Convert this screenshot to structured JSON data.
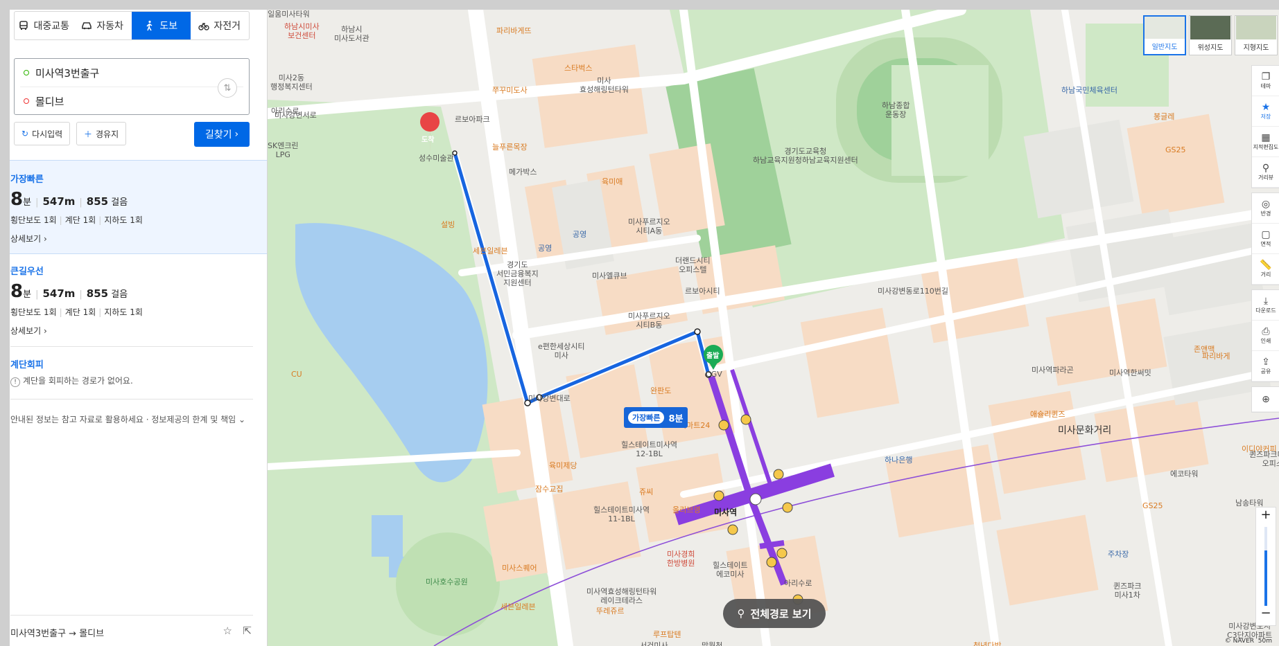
{
  "tabs": [
    {
      "label": "대중교통",
      "icon": "bus-icon"
    },
    {
      "label": "자동차",
      "icon": "car-icon"
    },
    {
      "label": "도보",
      "icon": "walk-icon"
    },
    {
      "label": "자전거",
      "icon": "bicycle-icon"
    }
  ],
  "active_tab": "도보",
  "start": "미사역3번출구",
  "destination": "몰디브",
  "buttons": {
    "reset": "다시입력",
    "waypoint": "경유지",
    "find": "길찾기"
  },
  "routes": [
    {
      "title": "가장빠른",
      "time": "8",
      "time_unit": "분",
      "distance": "547m",
      "steps": "855",
      "steps_unit": "걸음",
      "crosswalk": "횡단보도 1회",
      "stairs": "계단 1회",
      "underpass": "지하도 1회",
      "more": "상세보기"
    },
    {
      "title": "큰길우선",
      "time": "8",
      "time_unit": "분",
      "distance": "547m",
      "steps": "855",
      "steps_unit": "걸음",
      "crosswalk": "횡단보도 1회",
      "stairs": "계단 1회",
      "underpass": "지하도 1회",
      "more": "상세보기"
    }
  ],
  "stairs_avoid": {
    "title": "계단회피",
    "message": "계단을 회피하는 경로가 없어요."
  },
  "disclaimer": "안내된 정보는 참고 자료로 활용하세요 · 정보제공의 한계 및 책임",
  "footer": {
    "from": "미사역3번출구",
    "arrow": "→",
    "to": "몰디브"
  },
  "map": {
    "map_types": [
      "일반지도",
      "위성지도",
      "지형지도"
    ],
    "selected_map_type": "일반지도",
    "tools": [
      "테마",
      "저장",
      "지적편집도",
      "거리뷰",
      "반경",
      "면적",
      "거리",
      "다운로드",
      "인쇄",
      "공유"
    ],
    "route_badge": {
      "label": "가장빠른",
      "time": "8분"
    },
    "start_marker": "출발",
    "end_marker": "도착",
    "full_route_button": "전체경로 보기",
    "scale": "50m",
    "copyright": "© NAVER",
    "labels": [
      {
        "text": "하남시미사\n보건센터",
        "cls": "pink"
      },
      {
        "text": "하남시\n미사도서관",
        "cls": ""
      },
      {
        "text": "파리바게뜨",
        "cls": "orange"
      },
      {
        "text": "스타벅스",
        "cls": "orange"
      },
      {
        "text": "미사\n효성해링턴타워",
        "cls": ""
      },
      {
        "text": "쭈꾸미도사",
        "cls": "orange"
      },
      {
        "text": "르보아파크",
        "cls": ""
      },
      {
        "text": "늘푸른목장",
        "cls": "orange"
      },
      {
        "text": "메가박스",
        "cls": ""
      },
      {
        "text": "미사2동\n행정복지센터",
        "cls": ""
      },
      {
        "text": "아리수로",
        "cls": ""
      },
      {
        "text": "SK엔크린\nLPG",
        "cls": ""
      },
      {
        "text": "성수미술관",
        "cls": ""
      },
      {
        "text": "설빙",
        "cls": "orange"
      },
      {
        "text": "세븐일레븐",
        "cls": "orange"
      },
      {
        "text": "경기도\n서민금융복지\n지원센터",
        "cls": ""
      },
      {
        "text": "공영",
        "cls": "blue"
      },
      {
        "text": "공영",
        "cls": "blue"
      },
      {
        "text": "육미애",
        "cls": "orange"
      },
      {
        "text": "미사푸르지오\n시티A동",
        "cls": ""
      },
      {
        "text": "더랜드시티\n오피스텔",
        "cls": ""
      },
      {
        "text": "미사엘큐브",
        "cls": ""
      },
      {
        "text": "르보아시티",
        "cls": ""
      },
      {
        "text": "미사푸르지오\n시티B동",
        "cls": ""
      },
      {
        "text": "e편한세상시티\n미사",
        "cls": ""
      },
      {
        "text": "CGV",
        "cls": ""
      },
      {
        "text": "완판도",
        "cls": "orange"
      },
      {
        "text": "이마트24",
        "cls": "orange"
      },
      {
        "text": "힐스테이트미사역\n12-1BL",
        "cls": ""
      },
      {
        "text": "육미제당",
        "cls": "orange"
      },
      {
        "text": "잠수교집",
        "cls": "orange"
      },
      {
        "text": "쥬씨",
        "cls": "orange"
      },
      {
        "text": "올리브영",
        "cls": "orange"
      },
      {
        "text": "미사역",
        "cls": "bold"
      },
      {
        "text": "힐스테이트미사역\n11-1BL",
        "cls": ""
      },
      {
        "text": "미사경희\n한방병원",
        "cls": "pink"
      },
      {
        "text": "미사스퀘어",
        "cls": "orange"
      },
      {
        "text": "힐스테이트\n에코미사",
        "cls": ""
      },
      {
        "text": "미사역효성해링턴타워\n레이크테라스",
        "cls": ""
      },
      {
        "text": "세븐일레븐",
        "cls": "orange"
      },
      {
        "text": "뚜레쥬르",
        "cls": "orange"
      },
      {
        "text": "루프탑텐",
        "cls": "orange"
      },
      {
        "text": "미사호수공원",
        "cls": "green"
      },
      {
        "text": "하남종합\n운동장",
        "cls": ""
      },
      {
        "text": "경기도교육청\n하남교육지원청하남교육지원센터",
        "cls": ""
      },
      {
        "text": "하남국민체육센터",
        "cls": "blue"
      },
      {
        "text": "봉글레",
        "cls": "orange"
      },
      {
        "text": "GS25",
        "cls": "orange"
      },
      {
        "text": "미사강변동로110번길",
        "cls": ""
      },
      {
        "text": "미사역파라곤",
        "cls": ""
      },
      {
        "text": "애슐리퀸즈",
        "cls": "orange"
      },
      {
        "text": "하나은행",
        "cls": "blue"
      },
      {
        "text": "미사문화거리",
        "cls": "big"
      },
      {
        "text": "존앤맥",
        "cls": "orange"
      },
      {
        "text": "미사역한써밋",
        "cls": ""
      },
      {
        "text": "파리바게",
        "cls": "orange"
      },
      {
        "text": "이디야커피",
        "cls": "orange"
      },
      {
        "text": "에코타워",
        "cls": ""
      },
      {
        "text": "GS25",
        "cls": "orange"
      },
      {
        "text": "남송타워",
        "cls": ""
      },
      {
        "text": "주차장",
        "cls": "blue"
      },
      {
        "text": "퀸즈파크\n미사1차",
        "cls": ""
      },
      {
        "text": "퀸즈파크미사2차\n오피스텔",
        "cls": ""
      },
      {
        "text": "미사강변도시\nC3단지아파트",
        "cls": ""
      },
      {
        "text": "CU",
        "cls": "orange"
      },
      {
        "text": "미사강변대로",
        "cls": ""
      },
      {
        "text": "미사강변서로",
        "cls": ""
      },
      {
        "text": "아리수로",
        "cls": ""
      },
      {
        "text": "서건미사\n코스트타워",
        "cls": ""
      },
      {
        "text": "망월천",
        "cls": ""
      },
      {
        "text": "청년다방",
        "cls": "orange"
      },
      {
        "text": "일움미사타워",
        "cls": ""
      }
    ]
  }
}
